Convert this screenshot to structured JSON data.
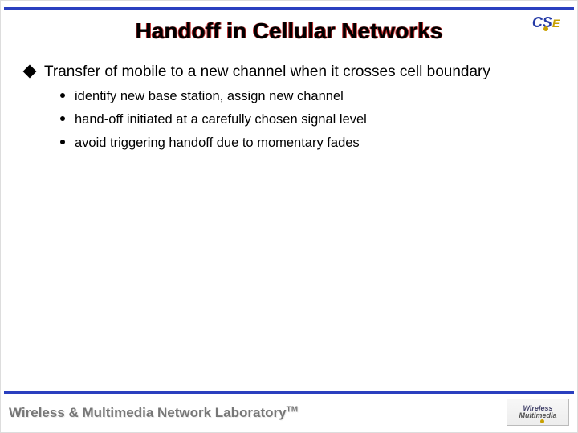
{
  "header": {
    "title": "Handoff in Cellular Networks",
    "logo_cse": "CSE"
  },
  "content": {
    "main_bullet": "Transfer of mobile to a new channel when it crosses cell boundary",
    "sub_bullets": [
      "identify new base station, assign new channel",
      "hand-off initiated at a carefully chosen signal level",
      "avoid triggering handoff due to momentary fades"
    ]
  },
  "footer": {
    "lab_text": "Wireless & Multimedia Network Laboratory",
    "tm": "TM",
    "logo_line1": "Wireless",
    "logo_line2": "Multimedia"
  }
}
